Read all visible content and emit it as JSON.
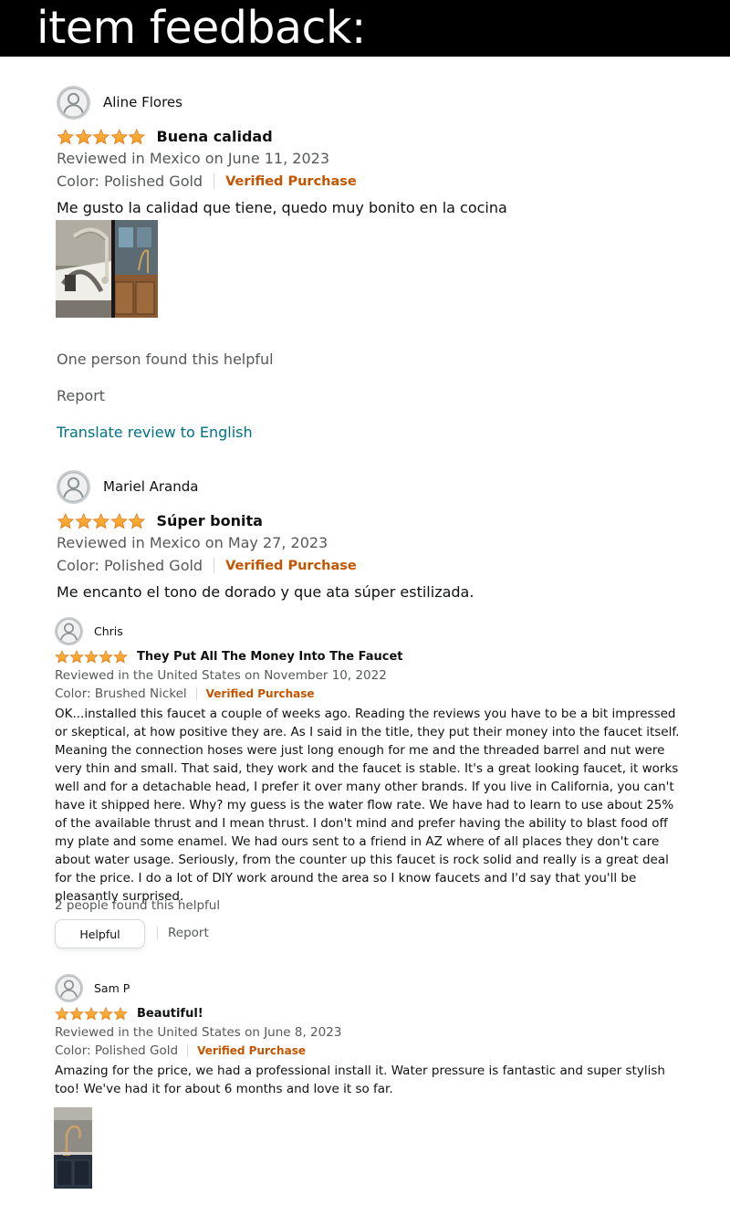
{
  "header": {
    "title": "item feedback:"
  },
  "colors": {
    "star": "#ffa41c",
    "verified": "#c45500",
    "link": "#007185",
    "muted": "#565959",
    "text": "#0f1111"
  },
  "reviews": [
    {
      "author": "Aline Flores",
      "rating": 5,
      "title": "Buena calidad",
      "date": "Reviewed in Mexico on June 11, 2023",
      "color": "Color: Polished Gold",
      "verified": "Verified Purchase",
      "body": "Me gusto la calidad que tiene, quedo muy bonito en la cocina",
      "helpful": "One person found this helpful",
      "report": "Report",
      "translate": "Translate review to English",
      "photos": [
        "faucet-photo",
        "kitchen-photo"
      ]
    },
    {
      "author": "Mariel Aranda",
      "rating": 5,
      "title": "Súper bonita",
      "date": "Reviewed in Mexico on May 27, 2023",
      "color": "Color: Polished Gold",
      "verified": "Verified Purchase",
      "body": "Me encanto el tono de dorado y que ata súper estilizada."
    },
    {
      "author": "Chris",
      "rating": 5,
      "title": "They Put All The Money Into The Faucet",
      "date": "Reviewed in the United States on November 10, 2022",
      "color": "Color: Brushed Nickel",
      "verified": "Verified Purchase",
      "body": "OK...installed this faucet a couple of weeks ago. Reading the reviews you have to be a bit impressed or skeptical, at how positive they are. As I said in the title, they put their money into the faucet itself. Meaning the connection hoses were just long enough for me and the threaded barrel and nut were very thin and small. That said, they work and the faucet is stable. It's a great looking faucet, it works well and for a detachable head, I prefer it over many other brands. If you live in California, you can't have it shipped here. Why? my guess is the water flow rate. We have had to learn to use about 25% of the available thrust and I mean thrust. I don't mind and prefer having the ability to blast food off my plate and some enamel. We had ours sent to a friend in AZ where of all places they don't care about water usage. Seriously, from the counter up this faucet is rock solid and really is a great deal for the price. I do a lot of DIY work around the area so I know faucets and I'd say that you'll be pleasantly surprised.",
      "helpful": "2 people found this helpful",
      "helpful_button": "Helpful",
      "report": "Report"
    },
    {
      "author": "Sam P",
      "rating": 5,
      "title": "Beautiful!",
      "date": "Reviewed in the United States on June 8, 2023",
      "color": "Color: Polished Gold",
      "verified": "Verified Purchase",
      "body": "Amazing for the price, we had a professional install it. Water pressure is fantastic and super stylish too! We've had it for about 6 months and love it so far.",
      "photos": [
        "installed-faucet-photo"
      ]
    }
  ]
}
